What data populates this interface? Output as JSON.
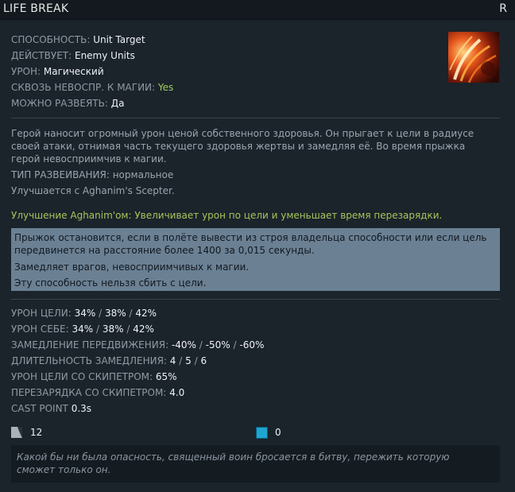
{
  "header": {
    "title": "LIFE BREAK",
    "hotkey": "R"
  },
  "ability_info": {
    "ability_label": "СПОСОБНОСТЬ:",
    "ability_value": "Unit Target",
    "affects_label": "ДЕЙСТВУЕТ:",
    "affects_value": "Enemy Units",
    "damage_label": "УРОН:",
    "damage_value": "Магический",
    "pierces_label": "СКВОЗЬ НЕВОСПР. К МАГИИ:",
    "pierces_value": "Yes",
    "dispellable_label": "МОЖНО РАЗВЕЯТЬ:",
    "dispellable_value": "Да",
    "icon": "life-break-icon"
  },
  "description": {
    "text": "Герой наносит огромный урон ценой собственного здоровья. Он прыгает к цели в радиусе своей атаки, отнимая часть текущего здоровья жертвы и замедляя её. Во время прыжка герой невосприимчив к магии.",
    "dispel_type": "ТИП РАЗВЕИВАНИЯ: нормальное",
    "upgrade": "Улучшается с Aghanim's Scepter."
  },
  "aghanim": {
    "text": "Улучшение Aghanim'ом: Увеличивает урон по цели и уменьшает время перезарядки."
  },
  "notes": [
    "Прыжок остановится, если в полёте вывести из строя владельца способности или если цель передвинется на расстояние более 1400 за 0,015 секунды.",
    "Замедляет врагов, невосприимчивых к магии.",
    "Эту способность нельзя сбить с цели."
  ],
  "stats": {
    "target_damage_label": "УРОН ЦЕЛИ:",
    "target_damage": [
      "34%",
      "38%",
      "42%"
    ],
    "self_damage_label": "УРОН СЕБЕ:",
    "self_damage": [
      "34%",
      "38%",
      "42%"
    ],
    "move_slow_label": "ЗАМЕДЛЕНИЕ ПЕРЕДВИЖЕНИЯ:",
    "move_slow": [
      "-40%",
      "-50%",
      "-60%"
    ],
    "slow_duration_label": "ДЛИТЕЛЬНОСТЬ ЗАМЕДЛЕНИЯ:",
    "slow_duration": [
      "4",
      "5",
      "6"
    ],
    "scepter_damage_label": "УРОН ЦЕЛИ СО СКИПЕТРОМ:",
    "scepter_damage": "65%",
    "scepter_cooldown_label": "ПЕРЕЗАРЯДКА СО СКИПЕТРОМ:",
    "scepter_cooldown": "4.0",
    "cast_point_label": "CAST POINT",
    "cast_point": "0.3s",
    "separator": "/"
  },
  "costs": {
    "cooldown": "12",
    "cooldown_icon": "cooldown-icon",
    "mana": "0",
    "mana_icon": "mana-icon",
    "mana_color": "#1fa4d0"
  },
  "lore": {
    "text": "Какой бы ни была опасность, священный воин бросается в битву, пережить которую сможет только он."
  }
}
